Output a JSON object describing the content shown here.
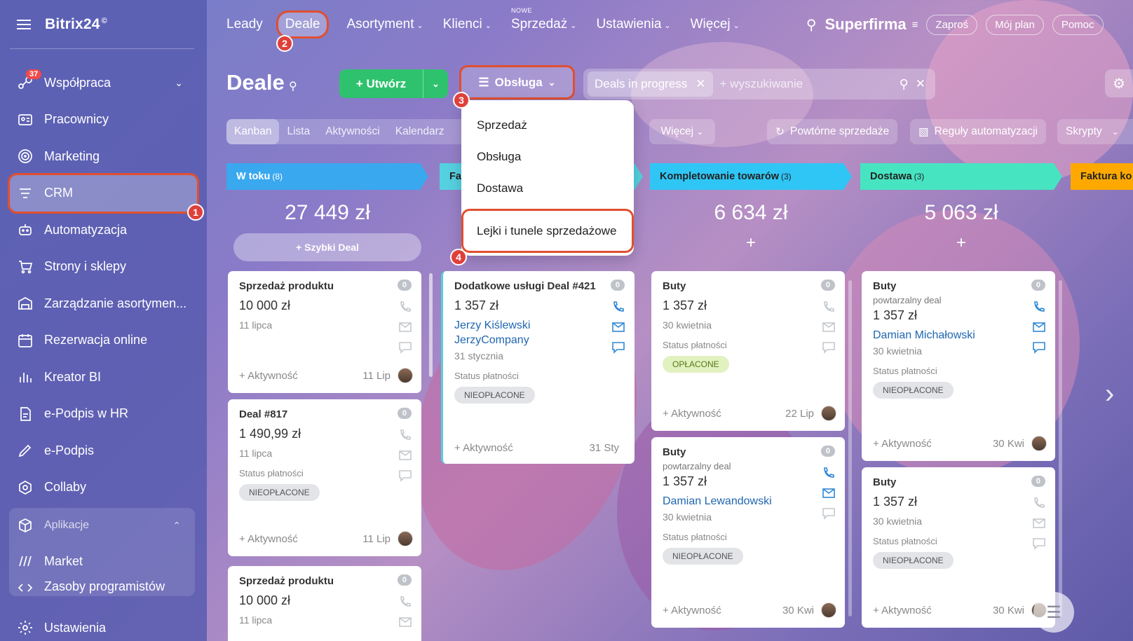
{
  "app": {
    "logo": "Bitrix24",
    "logo_mark": "©"
  },
  "sidebar": {
    "items": [
      {
        "label": "Współpraca",
        "badge": "37",
        "icon": "chat-icon"
      },
      {
        "label": "Pracownicy",
        "icon": "id-card-icon"
      },
      {
        "label": "Marketing",
        "icon": "target-icon"
      },
      {
        "label": "CRM",
        "icon": "filter-icon",
        "active": true
      },
      {
        "label": "Automatyzacja",
        "icon": "robot-icon"
      },
      {
        "label": "Strony i sklepy",
        "icon": "cart-icon"
      },
      {
        "label": "Zarządzanie asortymen...",
        "icon": "warehouse-icon"
      },
      {
        "label": "Rezerwacja online",
        "icon": "calendar-icon"
      },
      {
        "label": "Kreator BI",
        "icon": "bar-chart-icon"
      },
      {
        "label": "e-Podpis w HR",
        "icon": "document-icon"
      },
      {
        "label": "e-Podpis",
        "icon": "pen-icon"
      },
      {
        "label": "Collaby",
        "icon": "hexagon-icon"
      }
    ],
    "apps_label": "Aplikacje",
    "apps_items": [
      {
        "label": "Market",
        "icon": "market-icon"
      },
      {
        "label": "Zasoby programistów",
        "icon": "code-icon"
      }
    ],
    "settings_label": "Ustawienia"
  },
  "steps": [
    "1",
    "2",
    "3",
    "4"
  ],
  "topnav": {
    "items": [
      {
        "label": "Leady",
        "dropdown": false
      },
      {
        "label": "Deale",
        "dropdown": false,
        "active": true
      },
      {
        "label": "Asortyment",
        "dropdown": true
      },
      {
        "label": "Klienci",
        "dropdown": true
      },
      {
        "label": "Sprzedaż",
        "dropdown": true,
        "badge": "NOWE"
      },
      {
        "label": "Ustawienia",
        "dropdown": true
      },
      {
        "label": "Więcej",
        "dropdown": true
      }
    ],
    "company": "Superfirma",
    "buttons": [
      "Zaproś",
      "Mój plan",
      "Pomoc"
    ]
  },
  "toolbar": {
    "title": "Deale",
    "create_label": "Utwórz",
    "pipeline_label": "Obsługa",
    "filter_chip": "Deals in progress",
    "search_placeholder": "+ wyszukiwanie"
  },
  "views": {
    "tabs": [
      "Kanban",
      "Lista",
      "Aktywności",
      "Kalendarz"
    ],
    "active": "Kanban",
    "more": "Więcej",
    "repeat_sales": "Powtórne sprzedaże",
    "automation": "Reguły automatyzacji",
    "scripts": "Skrypty"
  },
  "dropdown": {
    "items": [
      "Sprzedaż",
      "Obsługa",
      "Dostawa"
    ],
    "highlight": "Lejki i tunele sprzedażowe"
  },
  "columns": [
    {
      "title": "W toku",
      "count": "(8)",
      "sum": "27 449 zł",
      "color": "#39a8ef",
      "quick": "+  Szybki Deal"
    },
    {
      "title": "Fa",
      "count": "",
      "sum": "",
      "color": "#55d0e0"
    },
    {
      "title": "Kompletowanie towarów",
      "count": "(3)",
      "sum": "6 634 zł",
      "color": "#2fc6f6"
    },
    {
      "title": "Dostawa",
      "count": "(3)",
      "sum": "5 063 zł",
      "color": "#47e4c2"
    },
    {
      "title": "Faktura ko",
      "count": "",
      "sum": "",
      "color": "#ffa900"
    }
  ],
  "cards": {
    "c1": {
      "name": "Sprzedaż produktu",
      "amount": "10 000 zł",
      "date": "11 lipca",
      "activity": "+ Aktywność",
      "short": "11 Lip",
      "count": "0"
    },
    "c2": {
      "name": "Deal #817",
      "amount": "1 490,99 zł",
      "date": "11 lipca",
      "status_label": "Status płatności",
      "status": "NIEOPŁACONE",
      "activity": "+ Aktywność",
      "short": "11 Lip",
      "count": "0"
    },
    "c3": {
      "name": "Sprzedaż produktu",
      "amount": "10 000 zł",
      "date": "11 lipca",
      "count": "0"
    },
    "c4": {
      "name": "Dodatkowe usługi Deal #421",
      "amount": "1 357 zł",
      "contact": "Jerzy Kiślewski",
      "company": "JerzyCompany",
      "date": "31 stycznia",
      "status_label": "Status płatności",
      "status": "NIEOPŁACONE",
      "activity": "+ Aktywność",
      "short": "31 Sty",
      "count": "0"
    },
    "c5": {
      "name": "Buty",
      "amount": "1 357 zł",
      "date": "30 kwietnia",
      "status_label": "Status płatności",
      "status": "OPŁACONE",
      "activity": "+ Aktywność",
      "short": "22 Lip",
      "count": "0"
    },
    "c6": {
      "name": "Buty",
      "sub": "powtarzalny deal",
      "amount": "1 357 zł",
      "contact": "Damian Lewandowski",
      "date": "30 kwietnia",
      "status_label": "Status płatności",
      "status": "NIEOPŁACONE",
      "activity": "+ Aktywność",
      "short": "30 Kwi",
      "count": "0"
    },
    "c7": {
      "name": "Buty",
      "sub": "powtarzalny deal",
      "amount": "1 357 zł",
      "contact": "Damian Michałowski",
      "date": "30 kwietnia",
      "status_label": "Status płatności",
      "status": "NIEOPŁACONE",
      "activity": "+ Aktywność",
      "short": "30 Kwi",
      "count": "0"
    },
    "c8": {
      "name": "Buty",
      "amount": "1 357 zł",
      "date": "30 kwietnia",
      "status_label": "Status płatności",
      "status": "NIEOPŁACONE",
      "activity": "+ Aktywność",
      "short": "30 Kwi",
      "count": "0"
    }
  },
  "colors": {
    "accent_green": "#2fc26e",
    "highlight_red": "#e04f2f",
    "link_blue": "#2067b0"
  }
}
